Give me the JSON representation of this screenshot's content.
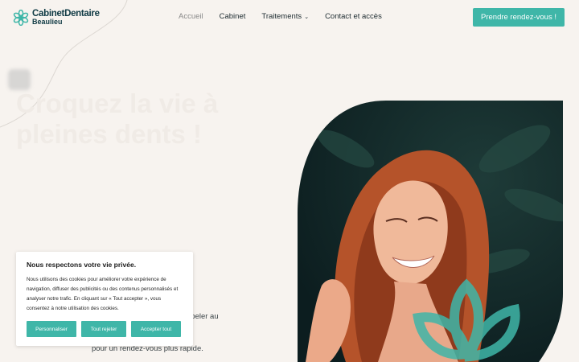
{
  "brand": {
    "name": "CabinetDentaire",
    "location": "Beaulieu",
    "accent_color": "#3fb6a8",
    "logo_icon": "flower-icon"
  },
  "nav": {
    "items": [
      {
        "label": "Accueil",
        "active": true
      },
      {
        "label": "Cabinet",
        "active": false
      },
      {
        "label": "Traitements",
        "active": false,
        "has_dropdown": true
      },
      {
        "label": "Contact et accès",
        "active": false
      }
    ],
    "cta_label": "Prendre rendez-vous !"
  },
  "hero": {
    "title": "Croquez la vie à pleines dents !",
    "text_fragment_1": "ppeler au",
    "text_fragment_2": "pour un rendez-vous plus rapide."
  },
  "cookie_banner": {
    "title": "Nous respectons votre vie privée.",
    "body": "Nous utilisons des cookies pour améliorer votre expérience de navigation, diffuser des publicités ou des contenus personnalisés et analyser notre trafic. En cliquant sur « Tout accepter », vous consentez à notre utilisation des cookies.",
    "buttons": {
      "customize": "Personnaliser",
      "reject": "Tout rejeter",
      "accept": "Accepter tout"
    }
  }
}
